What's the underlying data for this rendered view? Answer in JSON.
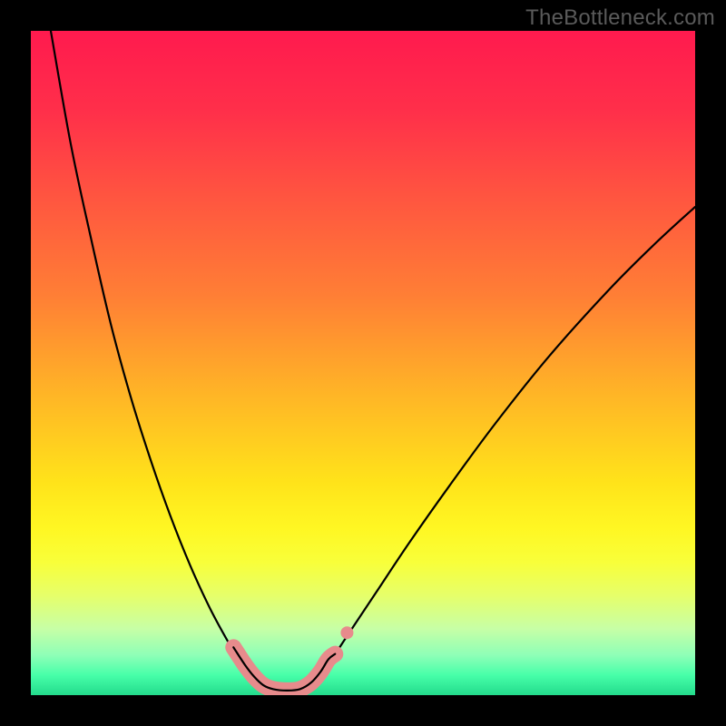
{
  "watermark": "TheBottleneck.com",
  "colors": {
    "frame_bg": "#000000",
    "watermark": "#5a5a5a",
    "curve_stroke": "#000000",
    "marker_fill": "#e78b8c",
    "gradient_stops": [
      {
        "offset": 0.0,
        "color": "#ff1a4e"
      },
      {
        "offset": 0.12,
        "color": "#ff2f4a"
      },
      {
        "offset": 0.25,
        "color": "#ff5540"
      },
      {
        "offset": 0.4,
        "color": "#ff7f35"
      },
      {
        "offset": 0.55,
        "color": "#ffb626"
      },
      {
        "offset": 0.68,
        "color": "#ffe31a"
      },
      {
        "offset": 0.75,
        "color": "#fff723"
      },
      {
        "offset": 0.8,
        "color": "#f8ff3a"
      },
      {
        "offset": 0.85,
        "color": "#e6ff6a"
      },
      {
        "offset": 0.9,
        "color": "#c7ffa6"
      },
      {
        "offset": 0.94,
        "color": "#8effb7"
      },
      {
        "offset": 0.97,
        "color": "#47ffa9"
      },
      {
        "offset": 1.0,
        "color": "#23db8c"
      }
    ]
  },
  "chart_data": {
    "type": "line",
    "title": "",
    "xlabel": "",
    "ylabel": "",
    "xlim": [
      0,
      100
    ],
    "ylim": [
      0,
      100
    ],
    "series": [
      {
        "name": "left-curve",
        "x": [
          3.0,
          6.0,
          9.0,
          12.0,
          15.0,
          18.0,
          21.0,
          24.0,
          27.0,
          30.0,
          31.5,
          33.0,
          34.2,
          35.2
        ],
        "values": [
          100,
          83.0,
          69.0,
          56.0,
          45.0,
          35.5,
          27.0,
          19.5,
          13.0,
          7.5,
          5.2,
          3.3,
          1.8,
          0.8
        ]
      },
      {
        "name": "right-curve",
        "x": [
          41.0,
          43.0,
          45.0,
          48.0,
          52.0,
          57.0,
          63.0,
          70.0,
          78.0,
          87.0,
          94.0,
          100.0
        ],
        "values": [
          0.8,
          2.5,
          5.0,
          9.5,
          15.5,
          23.0,
          31.5,
          41.0,
          51.0,
          61.0,
          68.0,
          73.5
        ]
      },
      {
        "name": "floor",
        "x": [
          35.2,
          37.0,
          39.0,
          41.0
        ],
        "values": [
          0.8,
          0.6,
          0.6,
          0.8
        ]
      }
    ],
    "markers": {
      "name": "highlight-points",
      "style": "thick-rounded",
      "x": [
        30.5,
        32.2,
        33.6,
        35.0,
        36.5,
        38.5,
        40.5,
        42.2,
        43.6,
        44.8,
        45.8
      ],
      "values": [
        7.2,
        4.6,
        2.8,
        1.5,
        0.9,
        0.7,
        0.9,
        1.9,
        3.5,
        5.4,
        6.2
      ]
    }
  }
}
